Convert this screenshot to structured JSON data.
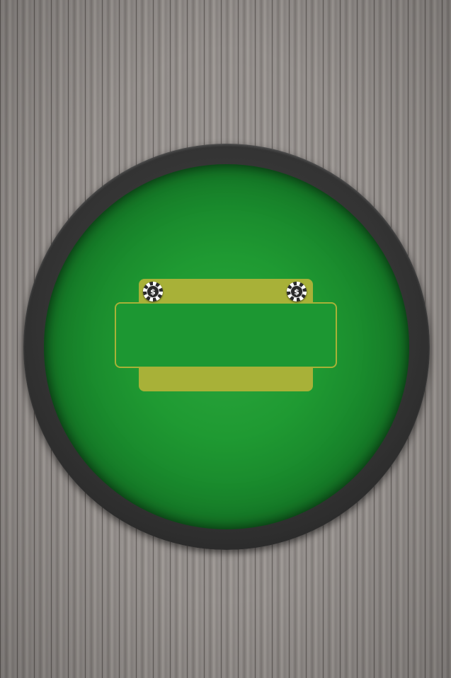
{
  "scene": {
    "type": "poker-table",
    "background": "wood-planks",
    "felt_color": "#1f9a32",
    "rim_color": "#333333",
    "panel_color": "#a8b138"
  },
  "chips": [
    {
      "name": "dealer-chip-left",
      "icon": "dollar-chip-icon",
      "symbol": "$"
    },
    {
      "name": "dealer-chip-right",
      "icon": "dollar-chip-icon",
      "symbol": "$"
    }
  ]
}
